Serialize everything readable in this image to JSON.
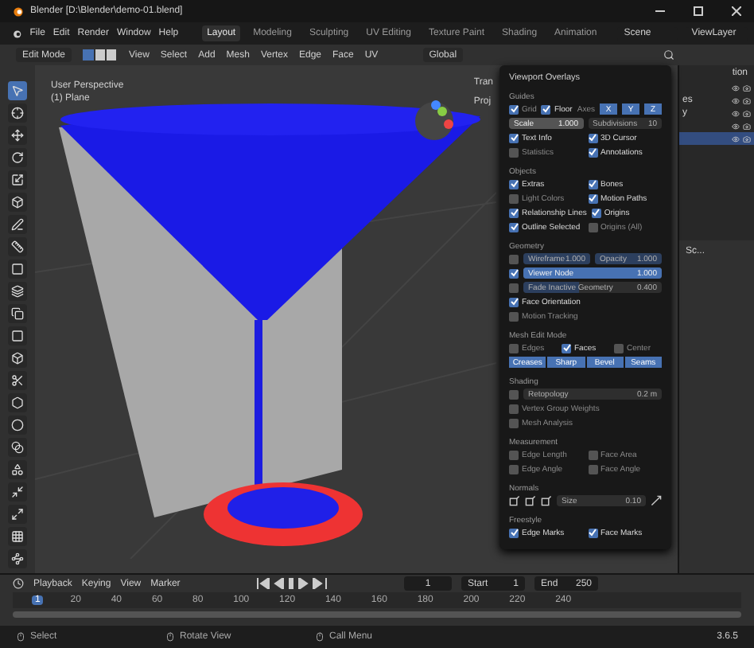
{
  "window": {
    "title": "Blender [D:\\Blender\\demo-01.blend]"
  },
  "menu": [
    "File",
    "Edit",
    "Render",
    "Window",
    "Help"
  ],
  "workspaces": [
    {
      "label": "Layout",
      "selected": true
    },
    {
      "label": "Modeling",
      "selected": false
    },
    {
      "label": "Sculpting",
      "selected": false
    },
    {
      "label": "UV Editing",
      "selected": false
    },
    {
      "label": "Texture Paint",
      "selected": false
    },
    {
      "label": "Shading",
      "selected": false
    },
    {
      "label": "Animation",
      "selected": false
    }
  ],
  "scene": "Scene",
  "view_layer": "ViewLayer",
  "header": {
    "mode": "Edit Mode",
    "menus": [
      "View",
      "Select",
      "Add",
      "Mesh",
      "Vertex",
      "Edge",
      "Face",
      "UV"
    ],
    "orientation": "Global"
  },
  "viewport": {
    "perspective": "User Perspective",
    "object": "(1) Plane",
    "side_tabs": [
      "Tran",
      "Proj"
    ]
  },
  "outliner": {
    "title": "tion",
    "rows": [
      {
        "selected": false
      },
      {
        "label": "es",
        "selected": false
      },
      {
        "label": "y",
        "selected": false
      },
      {
        "selected": false
      },
      {
        "selected": true
      }
    ]
  },
  "properties": {
    "tab": "Sc..."
  },
  "overlays": {
    "title": "Viewport Overlays",
    "sections": [
      {
        "title": "Guides",
        "rows": [
          {
            "kind": "checks-axes",
            "items": [
              {
                "label": "Grid",
                "checked": true,
                "disabled": true
              },
              {
                "label": "Floor",
                "checked": true,
                "disabled": false
              }
            ],
            "label": "Axes",
            "axes": [
              {
                "label": "X",
                "selected": true
              },
              {
                "label": "Y",
                "selected": true
              },
              {
                "label": "Z",
                "selected": true
              }
            ]
          },
          {
            "kind": "fields",
            "fields": [
              {
                "label": "Scale",
                "value": "1.000",
                "disabled": false
              },
              {
                "label": "Subdivisions",
                "value": "10",
                "disabled": true
              }
            ]
          },
          {
            "kind": "checks",
            "items": [
              {
                "label": "Text Info",
                "checked": true,
                "disabled": false
              },
              {
                "label": "3D Cursor",
                "checked": true,
                "disabled": false
              }
            ]
          },
          {
            "kind": "checks",
            "items": [
              {
                "label": "Statistics",
                "checked": false,
                "disabled": true
              },
              {
                "label": "Annotations",
                "checked": true,
                "disabled": false
              }
            ]
          }
        ]
      },
      {
        "title": "Objects",
        "rows": [
          {
            "kind": "checks",
            "items": [
              {
                "label": "Extras",
                "checked": true,
                "disabled": false
              },
              {
                "label": "Bones",
                "checked": true,
                "disabled": false
              }
            ]
          },
          {
            "kind": "checks",
            "items": [
              {
                "label": "Light Colors",
                "checked": false,
                "disabled": true
              },
              {
                "label": "Motion Paths",
                "checked": true,
                "disabled": false
              }
            ]
          },
          {
            "kind": "checks",
            "items": [
              {
                "label": "Relationship Lines",
                "checked": true,
                "disabled": false
              },
              {
                "label": "Origins",
                "checked": true,
                "disabled": false
              }
            ]
          },
          {
            "kind": "checks",
            "items": [
              {
                "label": "Outline Selected",
                "checked": true,
                "disabled": false
              },
              {
                "label": "Origins (All)",
                "checked": false,
                "disabled": true
              }
            ]
          }
        ]
      },
      {
        "title": "Geometry",
        "rows": [
          {
            "kind": "check-fields",
            "checked": false,
            "fields": [
              {
                "label": "Wireframe",
                "value": "1.000",
                "level": 1,
                "disabled": true
              },
              {
                "label": "Opacity",
                "value": "1.000",
                "level": 1,
                "disabled": true
              }
            ]
          },
          {
            "kind": "check-fields",
            "checked": true,
            "fields": [
              {
                "label": "Viewer Node",
                "value": "1.000",
                "level": 1,
                "disabled": false
              }
            ]
          },
          {
            "kind": "check-fields",
            "checked": false,
            "fields": [
              {
                "label": "Fade Inactive Geometry",
                "value": "0.400",
                "level": 0.4,
                "disabled": true
              }
            ]
          },
          {
            "kind": "checks",
            "items": [
              {
                "label": "Face Orientation",
                "checked": true,
                "disabled": false
              }
            ]
          },
          {
            "kind": "checks",
            "items": [
              {
                "label": "Motion Tracking",
                "checked": false,
                "disabled": true
              }
            ]
          }
        ]
      },
      {
        "title": "Mesh Edit Mode",
        "rows": [
          {
            "kind": "checks",
            "items": [
              {
                "label": "Edges",
                "checked": false,
                "disabled": true
              },
              {
                "label": "Faces",
                "checked": true,
                "disabled": false
              },
              {
                "label": "Center",
                "checked": false,
                "disabled": true
              }
            ]
          },
          {
            "kind": "buttons",
            "buttons": [
              {
                "label": "Creases",
                "selected": true
              },
              {
                "label": "Sharp",
                "selected": true
              },
              {
                "label": "Bevel",
                "selected": true
              },
              {
                "label": "Seams",
                "selected": true
              }
            ]
          }
        ]
      },
      {
        "title": "Shading",
        "rows": [
          {
            "kind": "check-fields",
            "checked": false,
            "fields": [
              {
                "label": "Retopology",
                "value": "0.2 m",
                "disabled": true
              }
            ]
          },
          {
            "kind": "checks",
            "items": [
              {
                "label": "Vertex Group Weights",
                "checked": false,
                "disabled": true
              }
            ]
          },
          {
            "kind": "checks",
            "items": [
              {
                "label": "Mesh Analysis",
                "checked": false,
                "disabled": true
              }
            ]
          }
        ]
      },
      {
        "title": "Measurement",
        "rows": [
          {
            "kind": "checks",
            "items": [
              {
                "label": "Edge Length",
                "checked": false,
                "disabled": true
              },
              {
                "label": "Face Area",
                "checked": false,
                "disabled": true
              }
            ]
          },
          {
            "kind": "checks",
            "items": [
              {
                "label": "Edge Angle",
                "checked": false,
                "disabled": true
              },
              {
                "label": "Face Angle",
                "checked": false,
                "disabled": true
              }
            ]
          }
        ]
      },
      {
        "title": "Normals",
        "rows": [
          {
            "kind": "normals",
            "field": {
              "label": "Size",
              "value": "0.10",
              "disabled": true
            }
          }
        ]
      },
      {
        "title": "Freestyle",
        "rows": [
          {
            "kind": "checks",
            "items": [
              {
                "label": "Edge Marks",
                "checked": true,
                "disabled": false
              },
              {
                "label": "Face Marks",
                "checked": true,
                "disabled": false
              }
            ]
          }
        ]
      }
    ]
  },
  "timeline": {
    "menus": [
      "Playback",
      "Keying",
      "View",
      "Marker"
    ],
    "frame": "1",
    "start_label": "Start",
    "start": "1",
    "end_label": "End",
    "end": "250",
    "ticks": [
      {
        "label": "1",
        "selected": true
      },
      {
        "label": "20",
        "selected": false
      },
      {
        "label": "40",
        "selected": false
      },
      {
        "label": "60",
        "selected": false
      },
      {
        "label": "80",
        "selected": false
      },
      {
        "label": "100",
        "selected": false
      },
      {
        "label": "120",
        "selected": false
      },
      {
        "label": "140",
        "selected": false
      },
      {
        "label": "160",
        "selected": false
      },
      {
        "label": "180",
        "selected": false
      },
      {
        "label": "200",
        "selected": false
      },
      {
        "label": "220",
        "selected": false
      },
      {
        "label": "240",
        "selected": false
      }
    ]
  },
  "status": {
    "items": [
      "Select",
      "Rotate View",
      "Call Menu"
    ],
    "version": "3.6.5"
  }
}
